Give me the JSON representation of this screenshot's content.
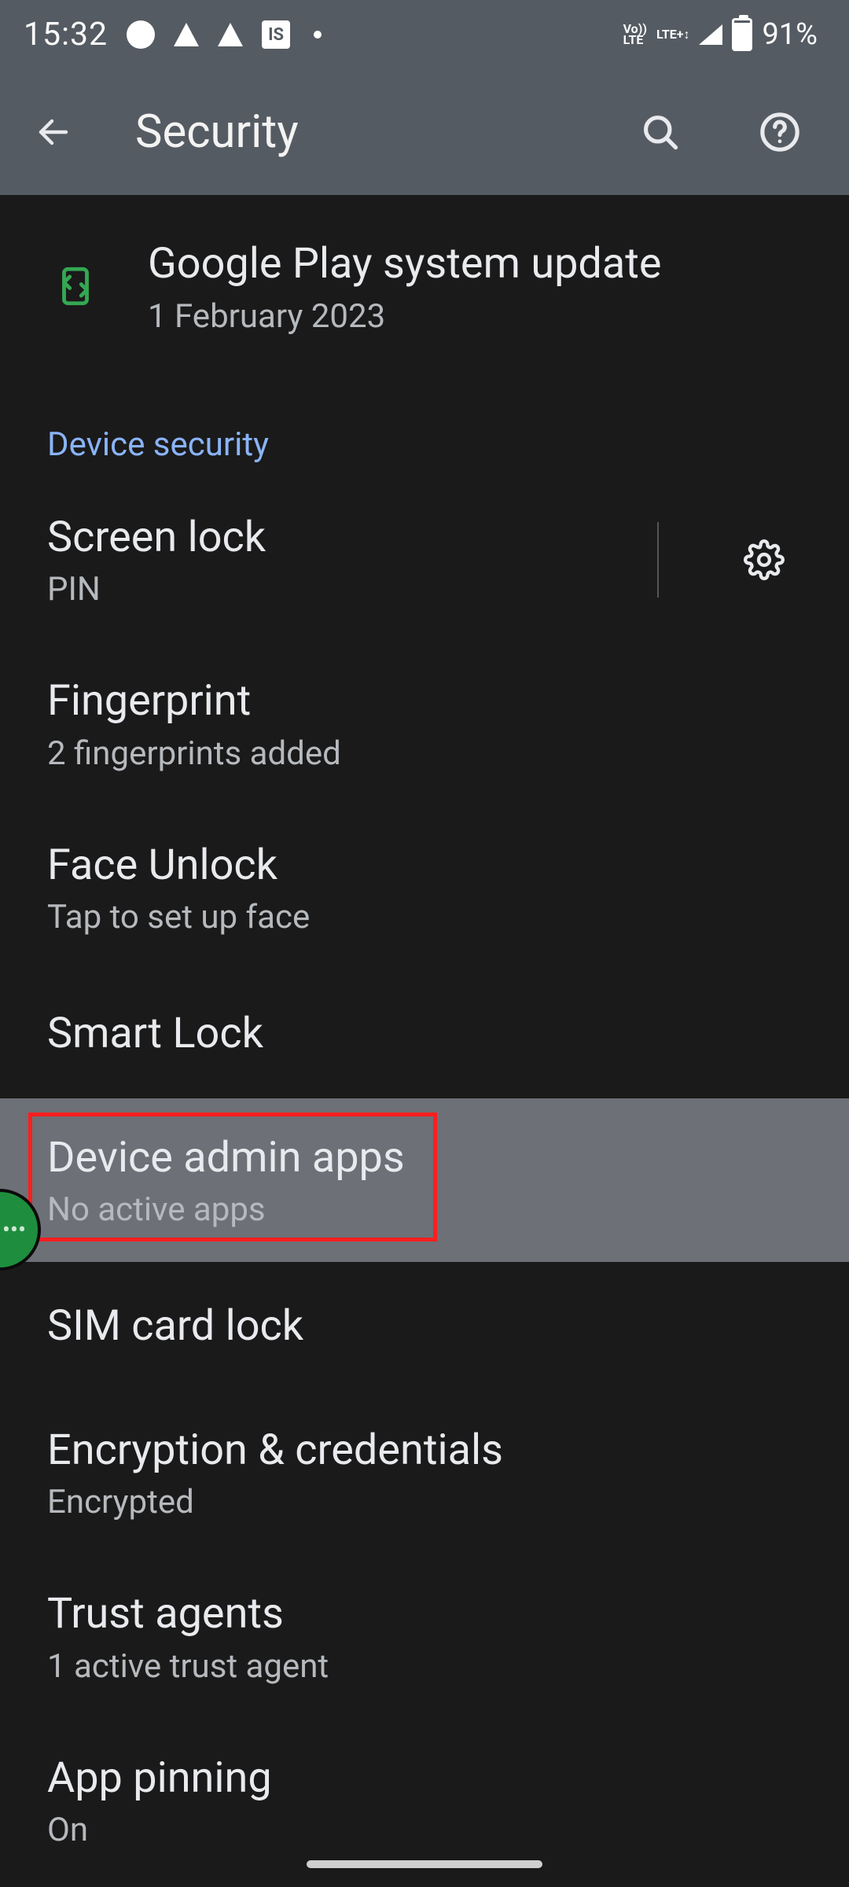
{
  "status": {
    "time": "15:32",
    "is_label": "IS",
    "volte": "Vo))\nLTE",
    "lteplus": "LTE+↕",
    "battery_pct": "91%"
  },
  "appbar": {
    "title": "Security"
  },
  "play_update": {
    "title": "Google Play system update",
    "summary": "1 February 2023"
  },
  "section_device_security": "Device security",
  "items": {
    "screen_lock": {
      "title": "Screen lock",
      "summary": "PIN"
    },
    "fingerprint": {
      "title": "Fingerprint",
      "summary": "2 fingerprints added"
    },
    "face_unlock": {
      "title": "Face Unlock",
      "summary": "Tap to set up face"
    },
    "smart_lock": {
      "title": "Smart Lock"
    },
    "device_admin": {
      "title": "Device admin apps",
      "summary": "No active apps"
    },
    "sim_lock": {
      "title": "SIM card lock"
    },
    "encryption": {
      "title": "Encryption & credentials",
      "summary": "Encrypted"
    },
    "trust_agents": {
      "title": "Trust agents",
      "summary": "1 active trust agent"
    },
    "app_pinning": {
      "title": "App pinning",
      "summary": "On"
    }
  }
}
